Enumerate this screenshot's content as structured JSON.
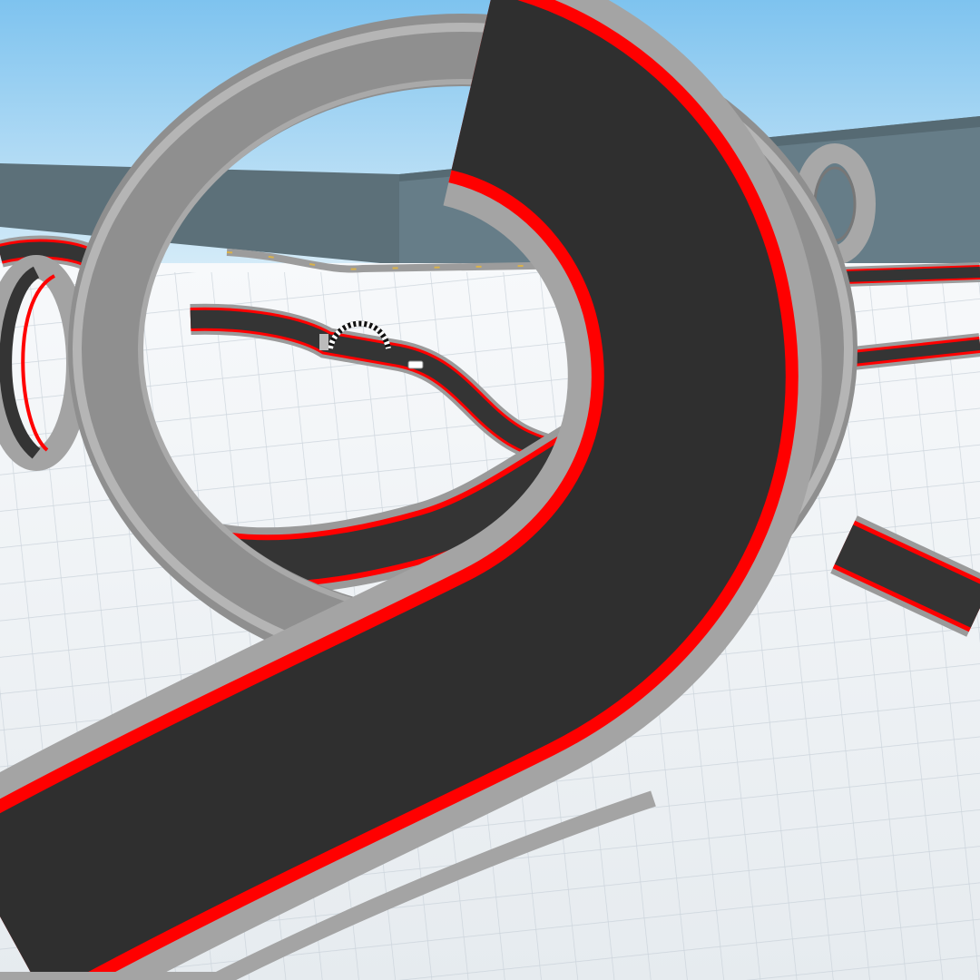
{
  "scene": {
    "colors": {
      "sky_top": "#7ec3ef",
      "sky_horizon": "#dceff9",
      "wall": "#5f7580",
      "floor": "#eef2f5",
      "grid_line": "#c5ced6",
      "track_surface": "#323232",
      "track_stripe": "#ff0000",
      "track_rail": "#a8a8a8",
      "checkered_arch": "#111111",
      "car": "#ffffff"
    },
    "objects": [
      "sky",
      "arena-wall",
      "grid-floor",
      "foreground-loop-track",
      "background-track",
      "checkered-finish-arch",
      "player-car"
    ]
  }
}
